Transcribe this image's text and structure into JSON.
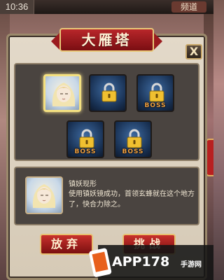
{
  "status_bar": {
    "time": "10:36",
    "channel_label": "频道"
  },
  "dialog": {
    "title": "大雁塔",
    "close_label": "X"
  },
  "stages": [
    {
      "state": "unlocked",
      "boss": ""
    },
    {
      "state": "locked",
      "boss": ""
    },
    {
      "state": "locked",
      "boss": "BOSS"
    },
    {
      "state": "locked",
      "boss": "BOSS"
    },
    {
      "state": "locked",
      "boss": "BOSS"
    }
  ],
  "info": {
    "title": "镇妖现形",
    "description": "使用镇妖镜成功，首领玄蜂就在这个地方了，快合力除之。"
  },
  "buttons": {
    "give_up": "放弃",
    "challenge": "挑战"
  },
  "watermark": {
    "brand": "APP178",
    "sub": "手游网"
  },
  "colors": {
    "accent": "#b8262a",
    "gold": "#e8c070"
  }
}
